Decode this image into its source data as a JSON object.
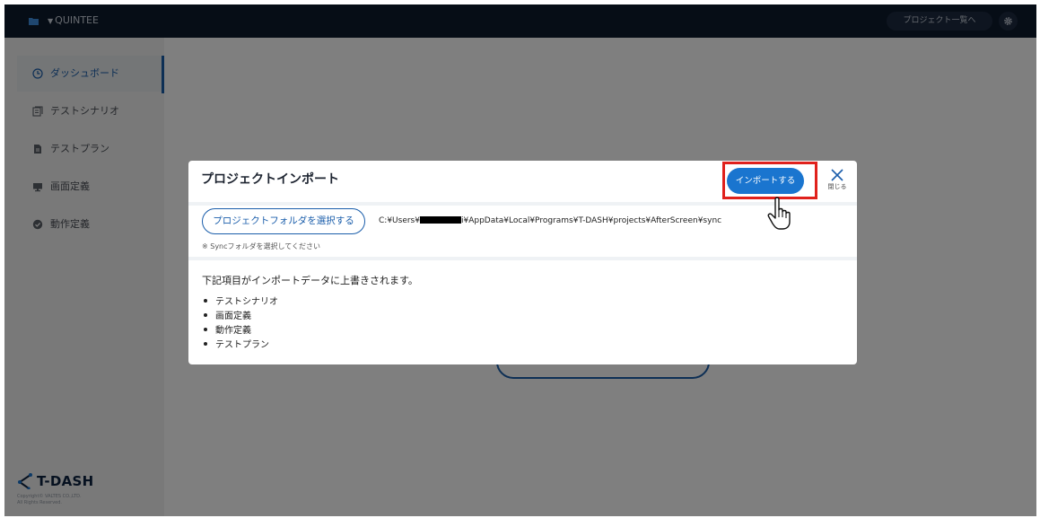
{
  "header": {
    "project_name": "QUINTEE",
    "project_list_label": "プロジェクト一覧へ"
  },
  "sidebar": {
    "items": [
      {
        "label": "ダッシュボード",
        "icon": "clock-icon",
        "active": true
      },
      {
        "label": "テストシナリオ",
        "icon": "scenario-icon",
        "active": false
      },
      {
        "label": "テストプラン",
        "icon": "document-icon",
        "active": false
      },
      {
        "label": "画面定義",
        "icon": "monitor-icon",
        "active": false
      },
      {
        "label": "動作定義",
        "icon": "check-circle-icon",
        "active": false
      }
    ],
    "logo_text": "T-DASH",
    "copyright_line1": "Copyright© VALTES CO.,LTD.",
    "copyright_line2": "All Rights Reserved."
  },
  "modal": {
    "title": "プロジェクトインポート",
    "import_button": "インポートする",
    "close_label": "閉じる",
    "select_folder_button": "プロジェクトフォルダを選択する",
    "path_prefix": "C:¥Users¥",
    "path_suffix": "i¥AppData¥Local¥Programs¥T-DASH¥projects¥AfterScreen¥sync",
    "note": "※ Syncフォルダを選択してください",
    "description": "下記項目がインポートデータに上書きされます。",
    "items": [
      "テストシナリオ",
      "画面定義",
      "動作定義",
      "テストプラン"
    ]
  },
  "colors": {
    "topbar": "#0d1a2d",
    "primary": "#1b5eab",
    "import_button": "#1a75cf",
    "highlight": "#e0211c"
  }
}
